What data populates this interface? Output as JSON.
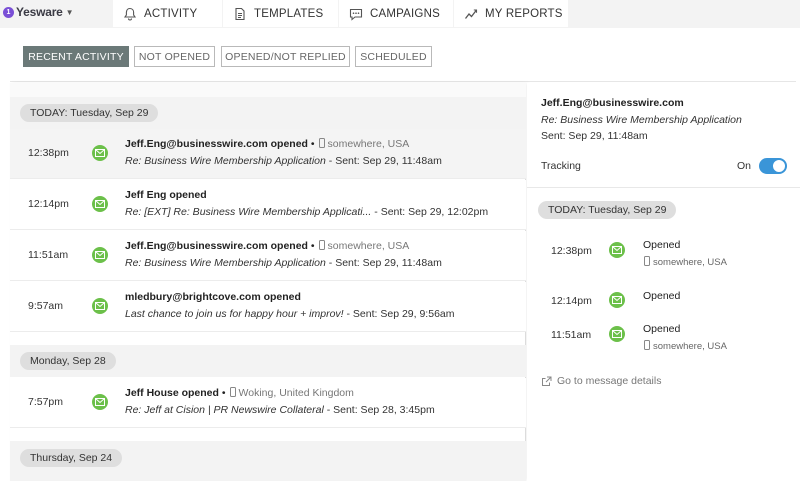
{
  "app": {
    "brand": "Yesware",
    "badge": "1"
  },
  "nav": {
    "tabs": [
      {
        "label": "ACTIVITY",
        "icon": "activity-icon"
      },
      {
        "label": "TEMPLATES",
        "icon": "templates-icon"
      },
      {
        "label": "CAMPAIGNS",
        "icon": "campaigns-icon"
      },
      {
        "label": "MY REPORTS",
        "icon": "reports-icon"
      }
    ]
  },
  "filters": {
    "tabs": [
      "RECENT ACTIVITY",
      "NOT OPENED",
      "OPENED/NOT REPLIED",
      "SCHEDULED"
    ],
    "active": "RECENT ACTIVITY"
  },
  "activity": {
    "groups": [
      {
        "date": "TODAY: Tuesday, Sep 29",
        "items": [
          {
            "time": "12:38pm",
            "who": "Jeff.Eng@businesswire.com opened",
            "location": "somewhere, USA",
            "subject": "Re: Business Wire Membership Application",
            "sent": " - Sent: Sep 29, 11:48am"
          },
          {
            "time": "12:14pm",
            "who": "Jeff Eng opened",
            "location": "",
            "subject": "Re: [EXT] Re: Business Wire Membership Applicati...",
            "sent": " - Sent: Sep 29, 12:02pm"
          },
          {
            "time": "11:51am",
            "who": "Jeff.Eng@businesswire.com opened",
            "location": "somewhere, USA",
            "subject": "Re: Business Wire Membership Application",
            "sent": " - Sent: Sep 29, 11:48am"
          },
          {
            "time": "9:57am",
            "who": "mledbury@brightcove.com opened",
            "location": "",
            "subject": "Last chance to join us for happy hour + improv!",
            "sent": " - Sent: Sep 29, 9:56am"
          }
        ]
      },
      {
        "date": "Monday, Sep 28",
        "items": [
          {
            "time": "7:57pm",
            "who": "Jeff House opened",
            "location": "Woking, United Kingdom",
            "subject": "Re: Jeff at Cision | PR Newswire Collateral",
            "sent": " - Sent: Sep 28, 3:45pm"
          }
        ]
      },
      {
        "date": "Thursday, Sep 24",
        "items": []
      }
    ]
  },
  "detail": {
    "email": "Jeff.Eng@businesswire.com",
    "subject": "Re: Business Wire Membership Application",
    "sent": "Sent: Sep 29, 11:48am",
    "tracking_label": "Tracking",
    "tracking_state": "On",
    "tracking_on": true,
    "date": "TODAY: Tuesday, Sep 29",
    "events": [
      {
        "time": "12:38pm",
        "label": "Opened",
        "location": "somewhere, USA"
      },
      {
        "time": "12:14pm",
        "label": "Opened",
        "location": ""
      },
      {
        "time": "11:51am",
        "label": "Opened",
        "location": "somewhere, USA"
      }
    ],
    "link": "Go to message details"
  },
  "colors": {
    "accent_green": "#6cc04a",
    "toggle_blue": "#3a95d8",
    "active_tab": "#6b7978",
    "brand_purple": "#7a4fd6"
  }
}
